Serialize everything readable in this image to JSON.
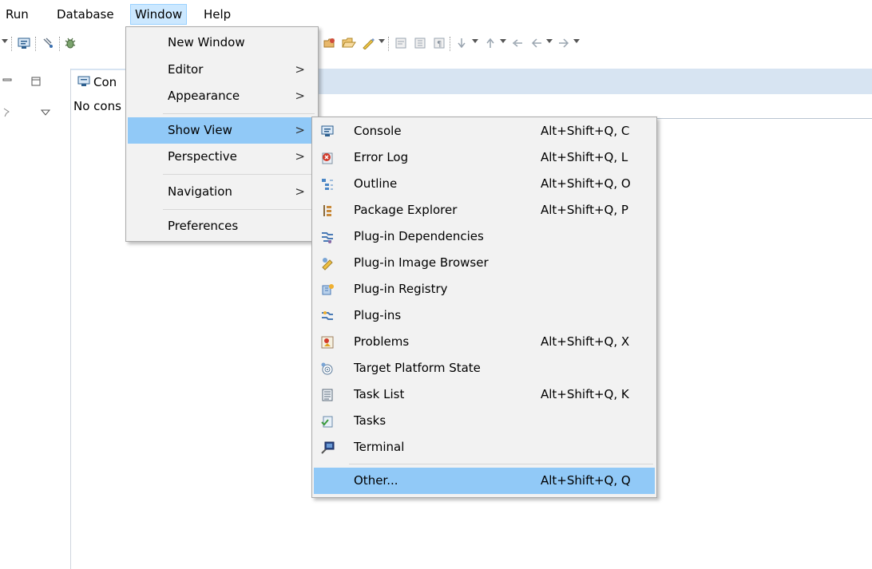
{
  "menubar": {
    "items": [
      {
        "label": "Run"
      },
      {
        "label": "Database"
      },
      {
        "label": "Window"
      },
      {
        "label": "Help"
      }
    ]
  },
  "console_view": {
    "tab_label": "Con",
    "body_text": "No cons"
  },
  "window_menu": {
    "items": [
      {
        "label": "New Window",
        "submenu": false
      },
      {
        "label": "Editor",
        "submenu": true
      },
      {
        "label": "Appearance",
        "submenu": true
      },
      {
        "label": "Show View",
        "submenu": true,
        "highlighted": true
      },
      {
        "label": "Perspective",
        "submenu": true
      },
      {
        "label": "Navigation",
        "submenu": true
      },
      {
        "label": "Preferences",
        "submenu": false
      }
    ],
    "submenu_arrow": ">"
  },
  "show_view_menu": {
    "items": [
      {
        "label": "Console",
        "shortcut": "Alt+Shift+Q, C",
        "icon": "console-icon"
      },
      {
        "label": "Error Log",
        "shortcut": "Alt+Shift+Q, L",
        "icon": "error-log-icon"
      },
      {
        "label": "Outline",
        "shortcut": "Alt+Shift+Q, O",
        "icon": "outline-icon"
      },
      {
        "label": "Package Explorer",
        "shortcut": "Alt+Shift+Q, P",
        "icon": "package-explorer-icon"
      },
      {
        "label": "Plug-in Dependencies",
        "shortcut": "",
        "icon": "plugin-dependencies-icon"
      },
      {
        "label": "Plug-in Image Browser",
        "shortcut": "",
        "icon": "plugin-image-browser-icon"
      },
      {
        "label": "Plug-in Registry",
        "shortcut": "",
        "icon": "plugin-registry-icon"
      },
      {
        "label": "Plug-ins",
        "shortcut": "",
        "icon": "plugins-icon"
      },
      {
        "label": "Problems",
        "shortcut": "Alt+Shift+Q, X",
        "icon": "problems-icon"
      },
      {
        "label": "Target Platform State",
        "shortcut": "",
        "icon": "target-platform-icon"
      },
      {
        "label": "Task List",
        "shortcut": "Alt+Shift+Q, K",
        "icon": "task-list-icon"
      },
      {
        "label": "Tasks",
        "shortcut": "",
        "icon": "tasks-icon"
      },
      {
        "label": "Terminal",
        "shortcut": "",
        "icon": "terminal-icon"
      },
      {
        "label": "Other...",
        "shortcut": "Alt+Shift+Q, Q",
        "icon": "",
        "highlighted": true
      }
    ]
  },
  "colors": {
    "menu_bg": "#f2f2f2",
    "highlight": "#91c9f7",
    "menubar_active": "#cce8ff",
    "view_tabbar": "#d7e4f2"
  }
}
